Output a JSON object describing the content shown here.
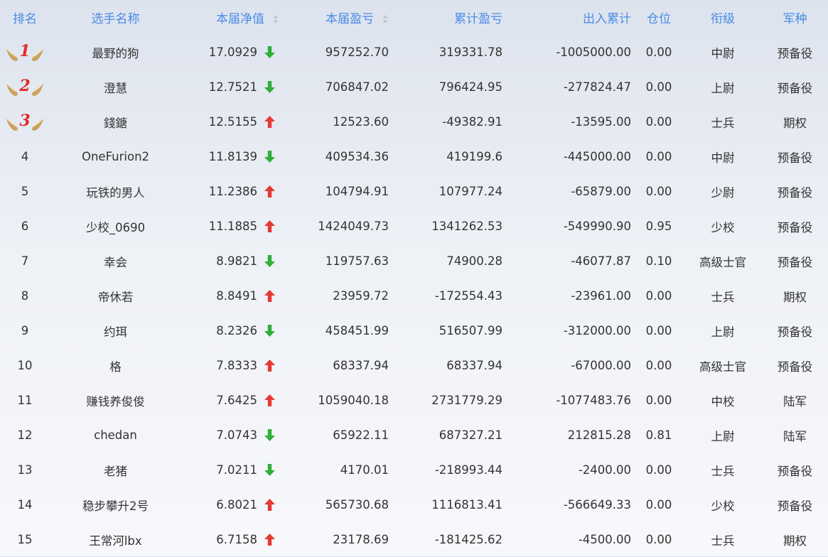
{
  "header": {
    "rank": "排名",
    "player": "选手名称",
    "nav": "本届净值",
    "pnl": "本届盈亏",
    "cum_pnl": "累计盈亏",
    "inout": "出入累计",
    "position": "仓位",
    "grade": "衔级",
    "service": "军种"
  },
  "colors": {
    "header_text": "#4a8be6",
    "trend_up": "#e53935",
    "trend_down": "#2fae3a",
    "medal_number": "#e02a2a",
    "medal_wing": "#c9a25e"
  },
  "rows": [
    {
      "rank": "1",
      "medal": true,
      "player": "最野的狗",
      "nav": "17.0929",
      "trend": "down",
      "pnl": "957252.70",
      "cum_pnl": "319331.78",
      "inout": "-1005000.00",
      "position": "0.00",
      "grade": "中尉",
      "service": "预备役"
    },
    {
      "rank": "2",
      "medal": true,
      "player": "澄慧",
      "nav": "12.7521",
      "trend": "down",
      "pnl": "706847.02",
      "cum_pnl": "796424.95",
      "inout": "-277824.47",
      "position": "0.00",
      "grade": "上尉",
      "service": "预备役"
    },
    {
      "rank": "3",
      "medal": true,
      "player": "錢鎕",
      "nav": "12.5155",
      "trend": "up",
      "pnl": "12523.60",
      "cum_pnl": "-49382.91",
      "inout": "-13595.00",
      "position": "0.00",
      "grade": "士兵",
      "service": "期权"
    },
    {
      "rank": "4",
      "player": "OneFurion2",
      "nav": "11.8139",
      "trend": "down",
      "pnl": "409534.36",
      "cum_pnl": "419199.6",
      "inout": "-445000.00",
      "position": "0.00",
      "grade": "中尉",
      "service": "预备役"
    },
    {
      "rank": "5",
      "player": "玩铁的男人",
      "nav": "11.2386",
      "trend": "up",
      "pnl": "104794.91",
      "cum_pnl": "107977.24",
      "inout": "-65879.00",
      "position": "0.00",
      "grade": "少尉",
      "service": "预备役"
    },
    {
      "rank": "6",
      "player": "少校_0690",
      "nav": "11.1885",
      "trend": "up",
      "pnl": "1424049.73",
      "cum_pnl": "1341262.53",
      "inout": "-549990.90",
      "position": "0.95",
      "grade": "少校",
      "service": "预备役"
    },
    {
      "rank": "7",
      "player": "幸会",
      "nav": "8.9821",
      "trend": "down",
      "pnl": "119757.63",
      "cum_pnl": "74900.28",
      "inout": "-46077.87",
      "position": "0.10",
      "grade": "高级士官",
      "service": "预备役"
    },
    {
      "rank": "8",
      "player": "帝休若",
      "nav": "8.8491",
      "trend": "up",
      "pnl": "23959.72",
      "cum_pnl": "-172554.43",
      "inout": "-23961.00",
      "position": "0.00",
      "grade": "士兵",
      "service": "期权"
    },
    {
      "rank": "9",
      "player": "约珥",
      "nav": "8.2326",
      "trend": "down",
      "pnl": "458451.99",
      "cum_pnl": "516507.99",
      "inout": "-312000.00",
      "position": "0.00",
      "grade": "上尉",
      "service": "预备役"
    },
    {
      "rank": "10",
      "player": "格",
      "nav": "7.8333",
      "trend": "up",
      "pnl": "68337.94",
      "cum_pnl": "68337.94",
      "inout": "-67000.00",
      "position": "0.00",
      "grade": "高级士官",
      "service": "预备役"
    },
    {
      "rank": "11",
      "player": "赚钱养俊俊",
      "nav": "7.6425",
      "trend": "up",
      "pnl": "1059040.18",
      "cum_pnl": "2731779.29",
      "inout": "-1077483.76",
      "position": "0.00",
      "grade": "中校",
      "service": "陆军"
    },
    {
      "rank": "12",
      "player": "chedan",
      "nav": "7.0743",
      "trend": "down",
      "pnl": "65922.11",
      "cum_pnl": "687327.21",
      "inout": "212815.28",
      "position": "0.81",
      "grade": "上尉",
      "service": "陆军"
    },
    {
      "rank": "13",
      "player": "老猪",
      "nav": "7.0211",
      "trend": "down",
      "pnl": "4170.01",
      "cum_pnl": "-218993.44",
      "inout": "-2400.00",
      "position": "0.00",
      "grade": "士兵",
      "service": "预备役"
    },
    {
      "rank": "14",
      "player": "稳步攀升2号",
      "nav": "6.8021",
      "trend": "up",
      "pnl": "565730.68",
      "cum_pnl": "1116813.41",
      "inout": "-566649.33",
      "position": "0.00",
      "grade": "少校",
      "service": "预备役"
    },
    {
      "rank": "15",
      "player": "王常河lbx",
      "nav": "6.7158",
      "trend": "up",
      "pnl": "23178.69",
      "cum_pnl": "-181425.62",
      "inout": "-4500.00",
      "position": "0.00",
      "grade": "士兵",
      "service": "期权"
    }
  ]
}
